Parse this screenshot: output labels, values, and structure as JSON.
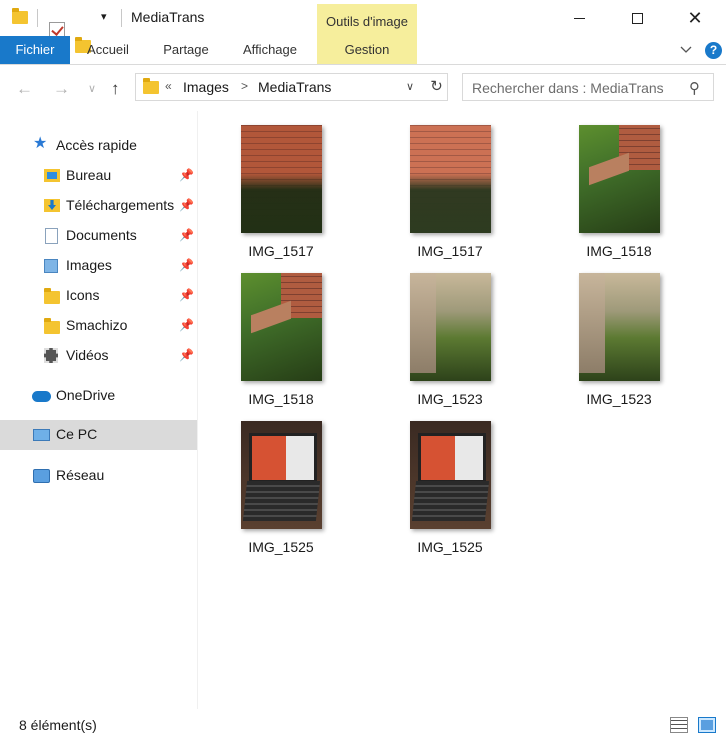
{
  "window": {
    "title": "MediaTrans",
    "contextual_tab_group": "Outils d'image"
  },
  "ribbon": {
    "tabs": [
      {
        "label": "Fichier",
        "active": true
      },
      {
        "label": "Accueil"
      },
      {
        "label": "Partage"
      },
      {
        "label": "Affichage"
      },
      {
        "label": "Gestion"
      }
    ]
  },
  "address_bar": {
    "overflow": "«",
    "crumbs": [
      "Images",
      "MediaTrans"
    ],
    "separator": ">"
  },
  "search": {
    "placeholder": "Rechercher dans : MediaTrans"
  },
  "sidebar": {
    "quick_access": {
      "label": "Accès rapide",
      "items": [
        {
          "label": "Bureau",
          "icon": "desktop-folder-icon",
          "pinned": true
        },
        {
          "label": "Téléchargements",
          "icon": "downloads-folder-icon",
          "pinned": true
        },
        {
          "label": "Documents",
          "icon": "documents-icon",
          "pinned": true
        },
        {
          "label": "Images",
          "icon": "pictures-icon",
          "pinned": true
        },
        {
          "label": "Icons",
          "icon": "folder-icon",
          "pinned": true
        },
        {
          "label": "Smachizo",
          "icon": "folder-icon",
          "pinned": true
        },
        {
          "label": "Vidéos",
          "icon": "videos-icon",
          "pinned": true
        }
      ]
    },
    "onedrive": "OneDrive",
    "this_pc": "Ce PC",
    "network": "Réseau"
  },
  "files": [
    {
      "name": "IMG_1517",
      "thumb": "garden-a"
    },
    {
      "name": "IMG_1517",
      "thumb": "garden-a light"
    },
    {
      "name": "IMG_1518",
      "thumb": "garden-b"
    },
    {
      "name": "IMG_1518",
      "thumb": "garden-b"
    },
    {
      "name": "IMG_1523",
      "thumb": "garden-c"
    },
    {
      "name": "IMG_1523",
      "thumb": "garden-c"
    },
    {
      "name": "IMG_1525",
      "thumb": "laptop"
    },
    {
      "name": "IMG_1525",
      "thumb": "laptop"
    }
  ],
  "status": {
    "item_count": "8 élément(s)"
  },
  "colors": {
    "accent": "#1979ca",
    "contextual": "#f6ee9c",
    "selection": "#dadada"
  }
}
